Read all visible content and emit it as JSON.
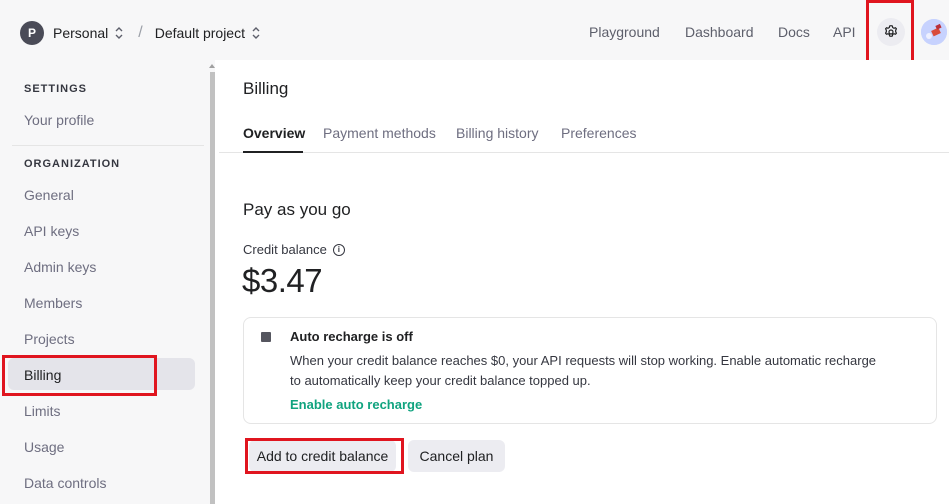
{
  "header": {
    "org_initial": "P",
    "org_name": "Personal",
    "separator": "/",
    "project_name": "Default project",
    "nav": [
      "Playground",
      "Dashboard",
      "Docs",
      "API"
    ],
    "settings_icon": "gear-icon"
  },
  "sidebar": {
    "settings_title": "SETTINGS",
    "settings_items": [
      "Your profile"
    ],
    "organization_title": "ORGANIZATION",
    "organization_items": [
      "General",
      "API keys",
      "Admin keys",
      "Members",
      "Projects",
      "Billing",
      "Limits",
      "Usage",
      "Data controls"
    ],
    "active_item": "Billing"
  },
  "main": {
    "title": "Billing",
    "tabs": [
      "Overview",
      "Payment methods",
      "Billing history",
      "Preferences"
    ],
    "active_tab": "Overview",
    "section_title": "Pay as you go",
    "credit_label": "Credit balance",
    "credit_value": "$3.47",
    "auto_recharge": {
      "title": "Auto recharge is off",
      "line1": "When your credit balance reaches $0, your API requests will stop working. Enable automatic recharge",
      "line2": "to automatically keep your credit balance topped up.",
      "link": "Enable auto recharge"
    },
    "buttons": {
      "add_credit": "Add to credit balance",
      "cancel_plan": "Cancel plan"
    }
  },
  "colors": {
    "accent_green": "#10a37f",
    "highlight_red": "#e0151f",
    "sidebar_bg": "#f7f7f8"
  }
}
